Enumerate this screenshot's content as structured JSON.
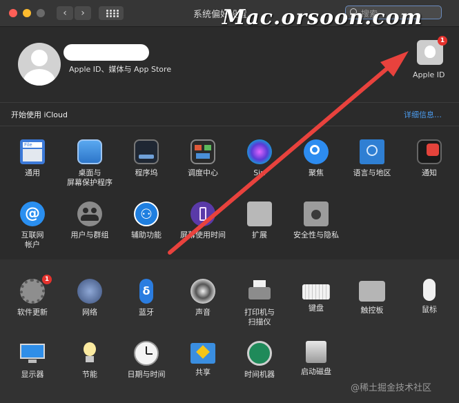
{
  "window": {
    "title": "系统偏好设置",
    "search_placeholder": "搜索",
    "watermark": "Mac.orsoon.com"
  },
  "account": {
    "subtitle": "Apple ID、媒体与 App Store",
    "apple_id_label": "Apple ID",
    "apple_id_badge": "1",
    "icloud_prompt": "开始使用 iCloud",
    "details_link": "详细信息…"
  },
  "panes_row1": [
    {
      "label": "通用",
      "icon": "general-icon"
    },
    {
      "label": "桌面与\n屏幕保护程序",
      "icon": "desktop-icon"
    },
    {
      "label": "程序坞",
      "icon": "dock-icon"
    },
    {
      "label": "调度中心",
      "icon": "mission-control-icon"
    },
    {
      "label": "Siri",
      "icon": "siri-icon"
    },
    {
      "label": "聚焦",
      "icon": "spotlight-icon"
    },
    {
      "label": "语言与地区",
      "icon": "language-icon"
    },
    {
      "label": "通知",
      "icon": "notifications-icon"
    }
  ],
  "panes_row2": [
    {
      "label": "互联网\n帐户",
      "icon": "internet-accounts-icon"
    },
    {
      "label": "用户与群组",
      "icon": "users-icon"
    },
    {
      "label": "辅助功能",
      "icon": "accessibility-icon"
    },
    {
      "label": "屏幕使用时间",
      "icon": "screen-time-icon"
    },
    {
      "label": "扩展",
      "icon": "extensions-icon"
    },
    {
      "label": "安全性与隐私",
      "icon": "security-icon"
    }
  ],
  "panes_row3": [
    {
      "label": "软件更新",
      "icon": "software-update-icon",
      "badge": "1"
    },
    {
      "label": "网络",
      "icon": "network-icon"
    },
    {
      "label": "蓝牙",
      "icon": "bluetooth-icon"
    },
    {
      "label": "声音",
      "icon": "sound-icon"
    },
    {
      "label": "打印机与\n扫描仪",
      "icon": "printer-icon"
    },
    {
      "label": "键盘",
      "icon": "keyboard-icon"
    },
    {
      "label": "触控板",
      "icon": "trackpad-icon"
    },
    {
      "label": "鼠标",
      "icon": "mouse-icon"
    }
  ],
  "panes_row4": [
    {
      "label": "显示器",
      "icon": "display-icon"
    },
    {
      "label": "节能",
      "icon": "energy-saver-icon"
    },
    {
      "label": "日期与时间",
      "icon": "date-time-icon"
    },
    {
      "label": "共享",
      "icon": "sharing-icon"
    },
    {
      "label": "时间机器",
      "icon": "time-machine-icon"
    },
    {
      "label": "启动磁盘",
      "icon": "startup-disk-icon"
    }
  ],
  "footer": {
    "credit": "@稀土掘金技术社区"
  },
  "colors": {
    "accent_arrow": "#e8423d",
    "badge": "#e5322d",
    "link": "#4b9cf0"
  }
}
